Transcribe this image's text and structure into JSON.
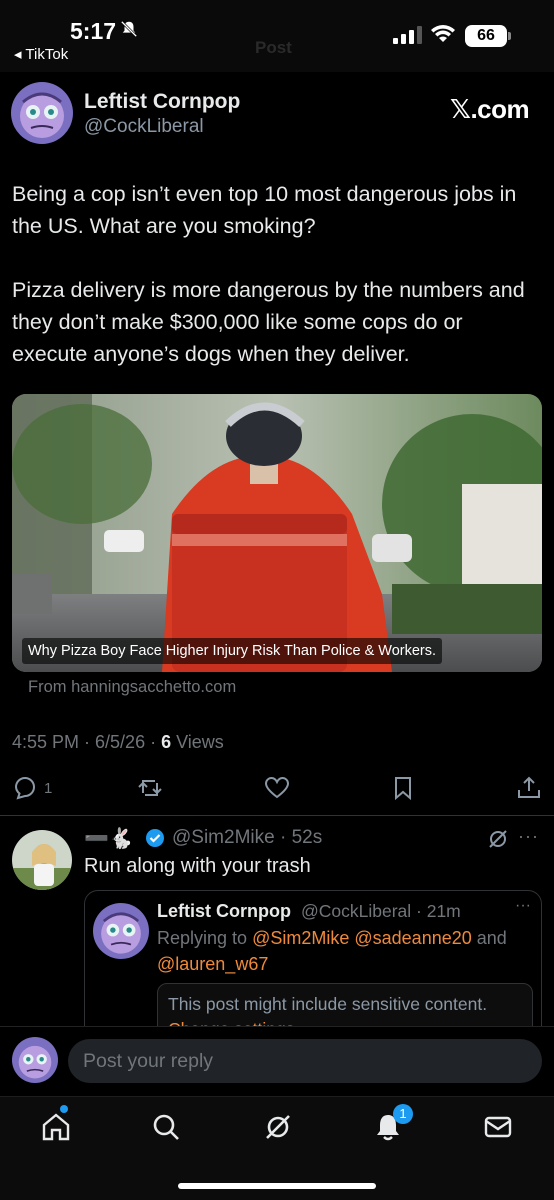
{
  "status_bar": {
    "time": "5:17",
    "back_app": "◂ TikTok",
    "ghost_title": "Post",
    "battery": "66"
  },
  "post": {
    "author_name": "Leftist Cornpop",
    "author_handle": "@CockLiberal",
    "brand": "𝕏.com",
    "text": "Being a cop isn’t even top 10 most dangerous jobs in the US. What are you smoking?\n\nPizza delivery is more dangerous by the numbers and they don’t make $300,000 like some cops do or execute anyone’s dogs when they deliver.",
    "media_caption": "Why Pizza Boy Face Higher Injury Risk Than Police & Workers.",
    "link_source": "From hanningsacchetto.com",
    "timestamp": "4:55 PM · 6/5/26 · ",
    "views_count": "6",
    "views_label": " Views"
  },
  "actions": {
    "reply_count": "1",
    "icons": [
      "reply-icon",
      "repost-icon",
      "like-icon",
      "bookmark-icon",
      "share-icon"
    ]
  },
  "reply": {
    "emoji_name": "➖🐇",
    "handle_time": "@Sim2Mike · 52s",
    "more": "···",
    "text": "Run along with your trash",
    "quote": {
      "name": "Leftist Cornpop",
      "handle_time": "@CockLiberal · 21m",
      "more": "···",
      "replying_prefix": "Replying to ",
      "mention_1": "@Sim2Mike",
      "mention_2": "@sadeanne20",
      "and": " and",
      "mention_3": "@lauren_w67",
      "sensitive_text": "This post might include sensitive content.",
      "change_settings": "Change settings"
    }
  },
  "composer": {
    "placeholder": "Post your reply"
  },
  "nav": {
    "notifications_badge": "1",
    "items": [
      "home-icon",
      "search-icon",
      "grok-icon",
      "notifications-icon",
      "messages-icon"
    ]
  },
  "colors": {
    "background": "#000000",
    "accent_link": "#f08a3b",
    "verified_blue": "#1d9bf0",
    "muted_text": "#71767b"
  }
}
